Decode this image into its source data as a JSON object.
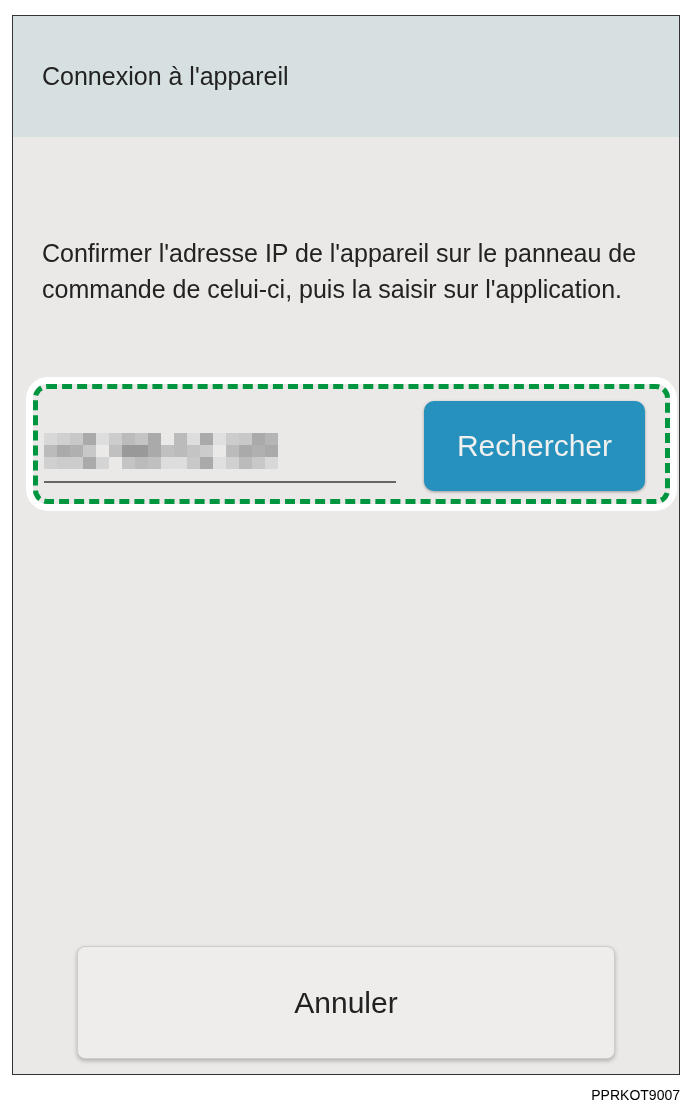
{
  "header": {
    "title": "Connexion à l'appareil"
  },
  "instruction": "Confirmer l'adresse IP de l'appareil sur le panneau de commande de celui-ci, puis la saisir sur l'application.",
  "search_button": {
    "label": "Rechercher"
  },
  "cancel_button": {
    "label": "Annuler"
  },
  "figure_code": "PPRKOT9007"
}
